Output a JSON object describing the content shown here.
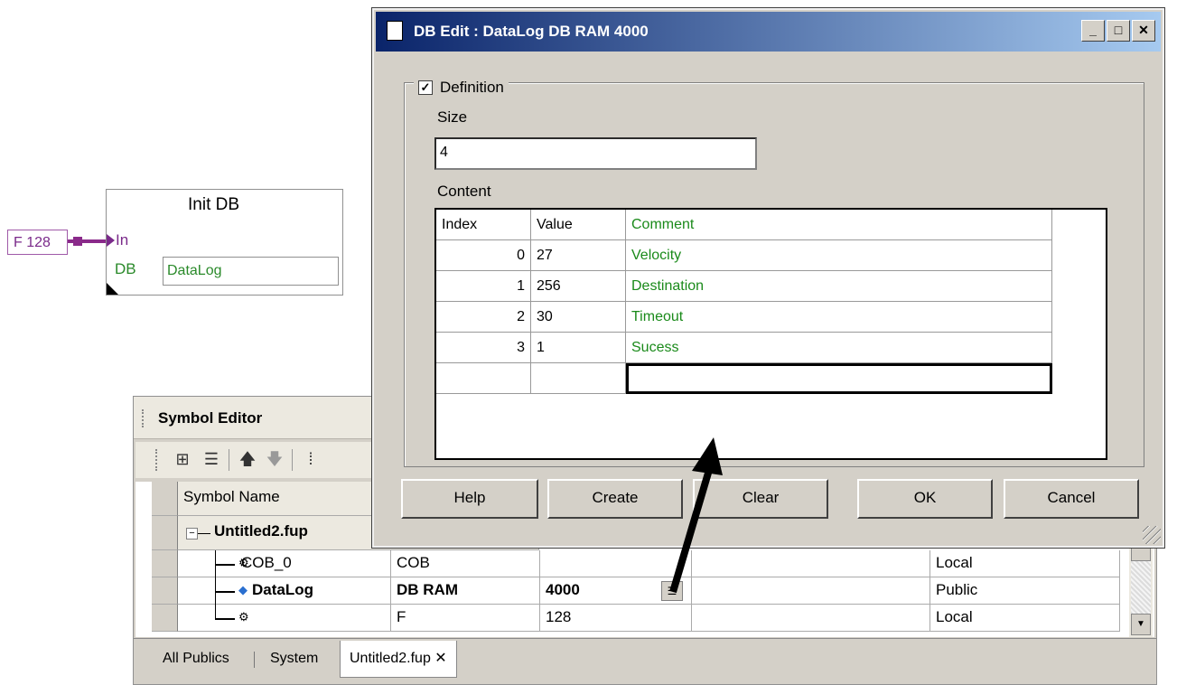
{
  "fup": {
    "const_label": "F 128",
    "block_title": "Init DB",
    "in_label": "In",
    "db_label": "DB",
    "db_value": "DataLog"
  },
  "symbol_editor": {
    "title": "Symbol Editor",
    "toolbar": {
      "icons": [
        "tree-view-icon",
        "list-view-icon",
        "move-up-icon",
        "move-down-icon",
        "column-icon"
      ]
    },
    "header": {
      "symbol_name": "Symbol Name"
    },
    "group": "Untitled2.fup",
    "rows": [
      {
        "name": "COB_0",
        "type": "COB",
        "address": "",
        "scope": "Local",
        "icon": "cob-symbol-icon"
      },
      {
        "name": "DataLog",
        "type": "DB RAM",
        "address": "4000",
        "scope": "Public",
        "icon": "datalog-diamond-icon"
      },
      {
        "name": "",
        "type": "F",
        "address": "128",
        "scope": "Local",
        "icon": "flag-symbol-icon"
      }
    ],
    "tabs": [
      {
        "label": "All Publics"
      },
      {
        "label": "System"
      },
      {
        "label": "Untitled2.fup ✕"
      }
    ]
  },
  "dialog": {
    "title": "DB Edit : DataLog DB RAM 4000",
    "caption_buttons": {
      "min": "_",
      "max": "□",
      "close": "✕"
    },
    "definition_label": "Definition",
    "definition_checked": true,
    "size_label": "Size",
    "size_value": "4",
    "content_label": "Content",
    "table": {
      "headers": {
        "index": "Index",
        "value": "Value",
        "comment": "Comment"
      },
      "rows": [
        {
          "index": "0",
          "value": "27",
          "comment": "Velocity"
        },
        {
          "index": "1",
          "value": "256",
          "comment": "Destination"
        },
        {
          "index": "2",
          "value": "30",
          "comment": "Timeout"
        },
        {
          "index": "3",
          "value": "1",
          "comment": "Sucess"
        }
      ]
    },
    "buttons": {
      "help": "Help",
      "create": "Create",
      "clear": "Clear",
      "ok": "OK",
      "cancel": "Cancel"
    }
  }
}
